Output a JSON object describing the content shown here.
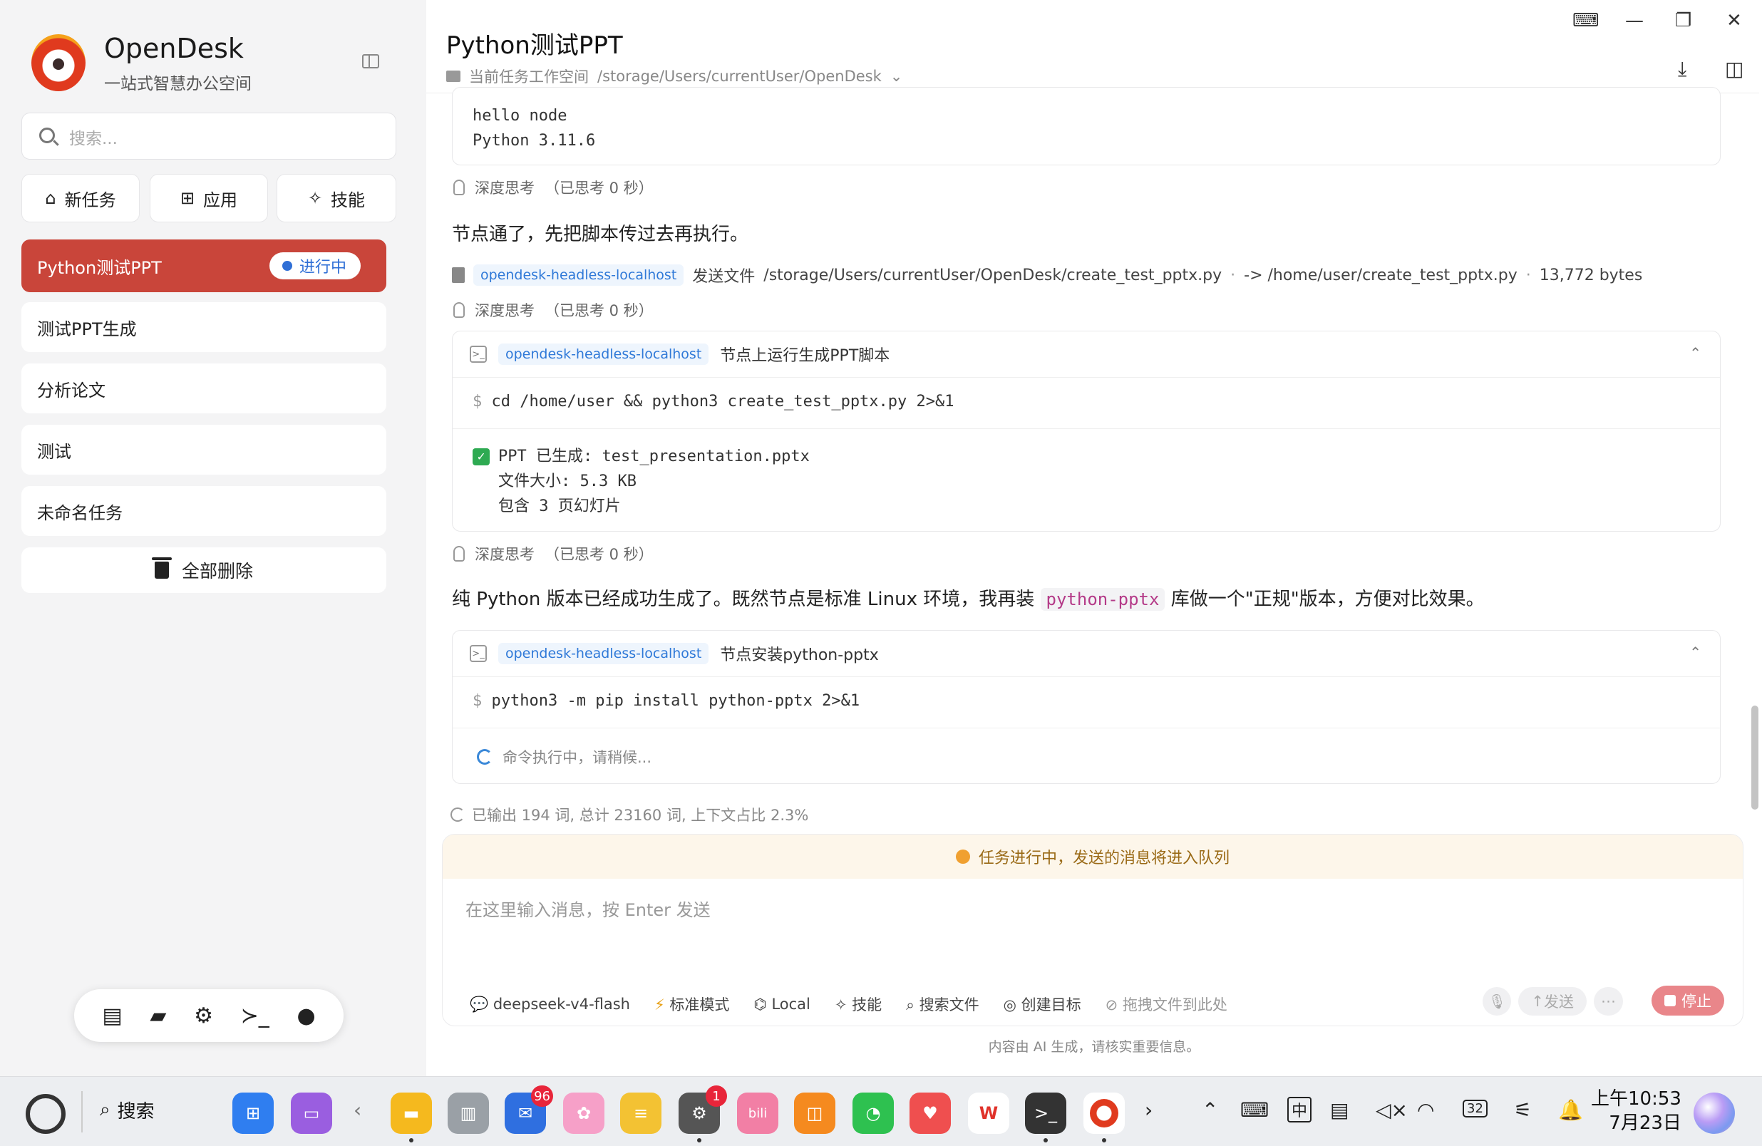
{
  "sidebar": {
    "brand": "OpenDesk",
    "brand_sub": "一站式智慧办公空间",
    "search_placeholder": "搜索...",
    "top_buttons": [
      {
        "label": "新任务",
        "icon": "home-icon"
      },
      {
        "label": "应用",
        "icon": "grid-icon"
      },
      {
        "label": "技能",
        "icon": "magic-wand-icon"
      }
    ],
    "tasks": [
      {
        "label": "Python测试PPT",
        "status": "进行中",
        "active": true
      },
      {
        "label": "测试PPT生成"
      },
      {
        "label": "分析论文"
      },
      {
        "label": "测试"
      },
      {
        "label": "未命名任务"
      }
    ],
    "delete_all": "全部删除",
    "dock_icons": [
      "server-icon",
      "folder-icon",
      "gear-icon",
      "terminal-icon",
      "user-icon"
    ]
  },
  "main": {
    "title": "Python测试PPT",
    "workspace_label": "当前任务工作空间",
    "workspace_path": "/storage/Users/currentUser/OpenDesk",
    "top_output": [
      "hello node",
      "Python 3.11.6"
    ],
    "think_label": "深度思考",
    "think_time": "（已思考 0 秒）",
    "msg1": "节点通了，先把脚本传过去再执行。",
    "send_file": {
      "node": "opendesk-headless-localhost",
      "action": "发送文件",
      "src": "/storage/Users/currentUser/OpenDesk/create_test_pptx.py",
      "arrow": "-> /home/user/create_test_pptx.py",
      "size": "13,772 bytes"
    },
    "cmd1": {
      "node": "opendesk-headless-localhost",
      "title": "节点上运行生成PPT脚本",
      "command": "cd /home/user && python3 create_test_pptx.py 2>&1",
      "output": [
        "PPT 已生成: test_presentation.pptx",
        "文件大小: 5.3 KB",
        "包含 3 页幻灯片"
      ]
    },
    "msg2_pre": "纯 Python 版本已经成功生成了。既然节点是标准 Linux 环境，我再装",
    "msg2_code": "python-pptx",
    "msg2_post": "库做一个\"正规\"版本，方便对比效果。",
    "cmd2": {
      "node": "opendesk-headless-localhost",
      "title": "节点安装python-pptx",
      "command": "python3 -m pip install python-pptx 2>&1",
      "running": "命令执行中，请稍候..."
    },
    "stats": "已输出 194 词, 总计 23160 词, 上下文占比 2.3%",
    "queue_notice": "任务进行中，发送的消息将进入队列",
    "input_placeholder": "在这里输入消息，按 Enter 发送",
    "toolbar": [
      "deepseek-v4-flash",
      "标准模式",
      "Local",
      "技能",
      "搜索文件",
      "创建目标",
      "拖拽文件到此处"
    ],
    "send": "发送",
    "stop": "停止",
    "disclaimer": "内容由 AI 生成，请核实重要信息。"
  },
  "taskbar": {
    "search": "搜索",
    "mail_badge": "96",
    "settings_badge": "1",
    "ime": "中",
    "battery": "32",
    "time": "上午10:53",
    "date": "7月23日"
  },
  "colors": {
    "accent": "#c9453a",
    "status_blue": "#2f6fd6",
    "chip_blue": "#2f79d8",
    "success_green": "#2eaa52"
  }
}
